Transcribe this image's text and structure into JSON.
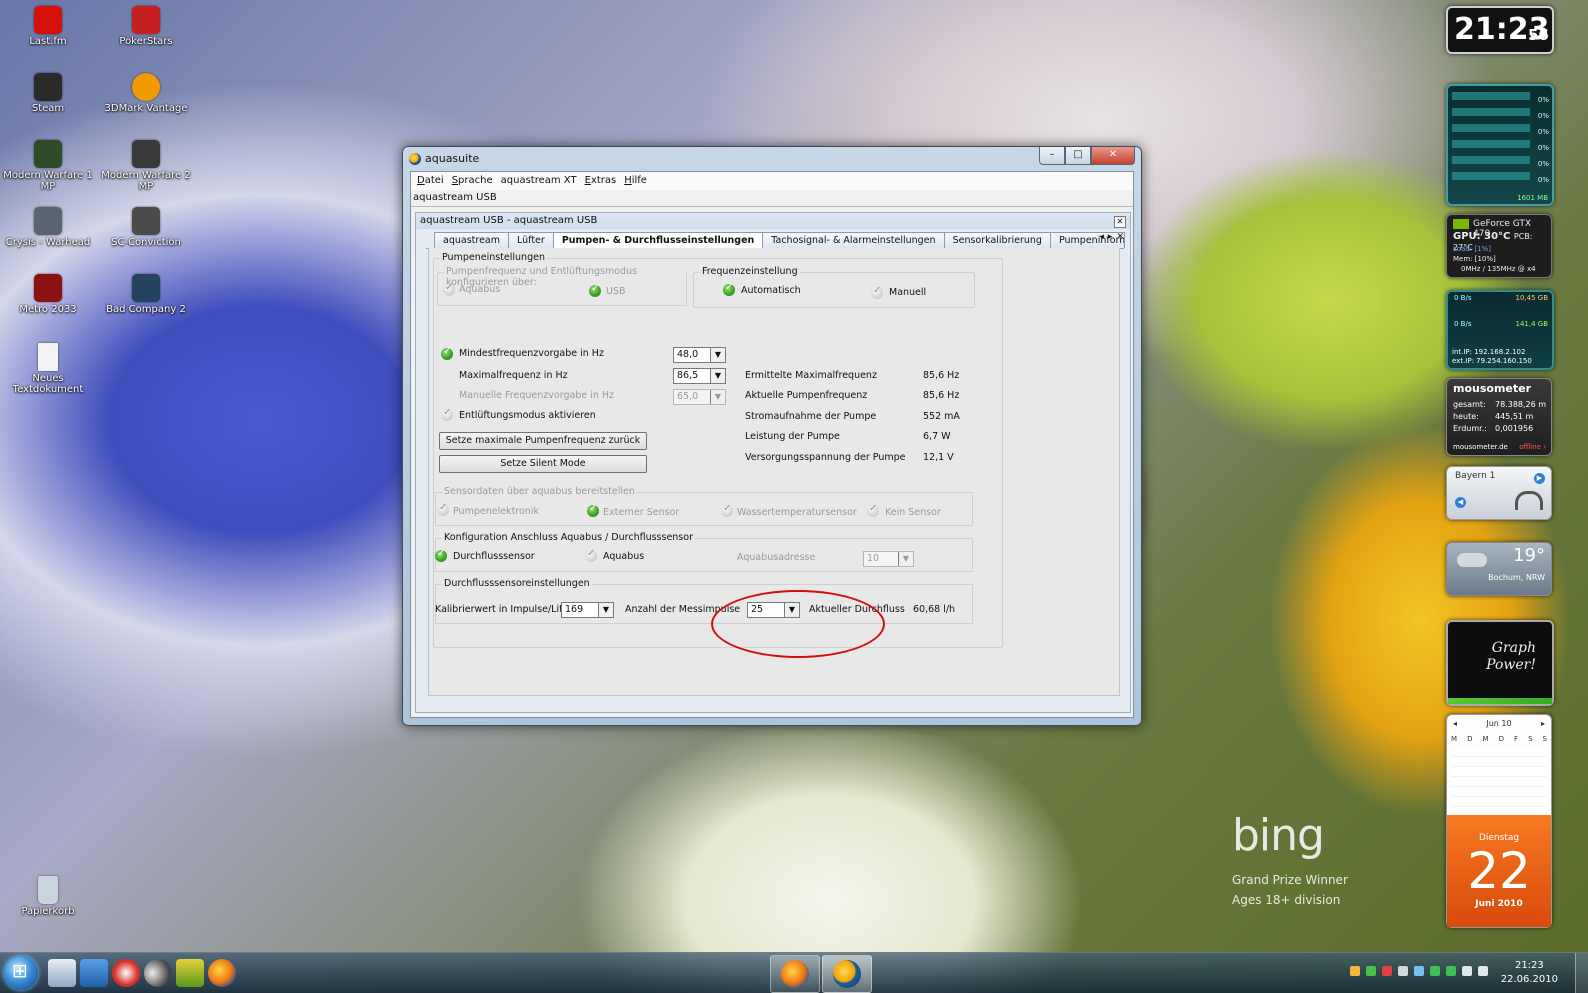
{
  "desktop": {
    "icons": [
      {
        "label": "Last.fm",
        "color": "#d51007"
      },
      {
        "label": "PokerStars",
        "color": "#c61f1f"
      },
      {
        "label": "Steam",
        "color": "#2a2a2a"
      },
      {
        "label": "3DMark Vantage",
        "color": "#f29a00"
      },
      {
        "label": "Modern Warfare 1 MP",
        "color": "#2e4b2a"
      },
      {
        "label": "Modern Warfare 2 MP",
        "color": "#3a3a3a"
      },
      {
        "label": "Crysis - Warhead",
        "color": "#5a6470"
      },
      {
        "label": "SC-Conviction",
        "color": "#4b4b4b"
      },
      {
        "label": "Metro 2033",
        "color": "#8b1010"
      },
      {
        "label": "Bad Company 2",
        "color": "#23435e"
      },
      {
        "label": "Neues Textdokument",
        "color": "#f3f3f3"
      },
      {
        "label": "Papierkorb",
        "color": "#c9d4df"
      }
    ],
    "bing": {
      "logo": "bing",
      "caption1": "Grand Prize Winner",
      "caption2": "Ages 18+ division"
    }
  },
  "gadgets": {
    "clock": {
      "time": "21:23",
      "seconds": "56"
    },
    "cpu": {
      "rows": [
        "0%",
        "0%",
        "0%",
        "0%",
        "0%",
        "0%"
      ],
      "footer": "1601 MB"
    },
    "gpu": {
      "title": "GeForce GTX 470",
      "gpu_temp": "GPU: 30°C",
      "pcb_temp": "PCB: 27°C",
      "load": "Load: [1%]",
      "mem": "Mem: [10%]",
      "clock": "0MHz / 135MHz @ x4"
    },
    "network": {
      "down": "0 B/s",
      "total_down": "10,45 GB",
      "up": "0 B/s",
      "total_up": "141,4 GB",
      "int_ip": "int.IP: 192.168.2.102",
      "ext_ip": "ext.IP: 79.254.160.150"
    },
    "mousometer": {
      "title": "mousometer",
      "gesamt_label": "gesamt:",
      "gesamt": "78.388,26 m",
      "heute_label": "heute:",
      "heute": "445,51 m",
      "erdumr_label": "Erdumr.:",
      "erdumr": "0,001956",
      "site": "mousometer.de",
      "status": "offline ›"
    },
    "radio": {
      "station": "Bayern 1"
    },
    "weather": {
      "temp": "19°",
      "location": "Bochum, NRW"
    },
    "graph": {
      "text": "Graph Power!"
    },
    "calendar": {
      "month": "Jun 10",
      "weekdays": [
        "M",
        "D",
        "M",
        "D",
        "F",
        "S",
        "S"
      ],
      "weekday_name": "Dienstag",
      "day": "22",
      "month_year": "Juni 2010"
    }
  },
  "window": {
    "title": "aquasuite",
    "menu": [
      {
        "key": "D",
        "rest": "atei"
      },
      {
        "key": "S",
        "rest": "prache"
      },
      {
        "key": "",
        "rest": "aquastream XT"
      },
      {
        "key": "E",
        "rest": "xtras"
      },
      {
        "key": "H",
        "rest": "ilfe"
      }
    ],
    "doc_strip": "aquastream USB",
    "child_title": "aquastream USB - aquastream USB",
    "tabs": [
      "aquastream",
      "Lüfter",
      "Pumpen- & Durchflusseinstellungen",
      "Tachosignal- & Alarmeinstellungen",
      "Sensorkalibrierung",
      "Pumpeninformationen & Schlüsse"
    ],
    "panel": {
      "pumpen_group": "Pumpeneinstellungen",
      "config_group": "Pumpenfrequenz und Entlüftungsmodus konfigurieren über:",
      "opt_aquabus": "Aquabus",
      "opt_usb": "USB",
      "freq_group": "Frequenzeinstellung",
      "opt_automatisch": "Automatisch",
      "opt_manuell": "Manuell",
      "min_freq_label": "Mindestfrequenzvorgabe in Hz",
      "min_freq_value": "48,0",
      "max_freq_label": "Maximalfrequenz in Hz",
      "max_freq_value": "86,5",
      "manual_freq_label": "Manuelle Frequenzvorgabe in Hz",
      "manual_freq_value": "65,0",
      "vent_label": "Entlüftungsmodus aktivieren",
      "btn_reset": "Setze maximale Pumpenfrequenz zurück",
      "btn_silent": "Setze Silent Mode",
      "info": [
        {
          "label": "Ermittelte Maximalfrequenz",
          "value": "85,6 Hz"
        },
        {
          "label": "Aktuelle Pumpenfrequenz",
          "value": "85,6 Hz"
        },
        {
          "label": "Stromaufnahme der Pumpe",
          "value": "552 mA"
        },
        {
          "label": "Leistung der Pumpe",
          "value": "6,7 W"
        },
        {
          "label": "Versorgungsspannung der Pumpe",
          "value": "12,1 V"
        }
      ],
      "sensor_group": "Sensordaten über aquabus bereitstellen",
      "sensor_opts": [
        "Pumpenelektronik",
        "Externer Sensor",
        "Wassertemperatursensor",
        "Kein Sensor"
      ],
      "anschluss_group": "Konfiguration Anschluss Aquabus / Durchflusssensor",
      "opt_durchfluss": "Durchflusssensor",
      "opt_aquabus2": "Aquabus",
      "aquabus_addr_label": "Aquabusadresse",
      "aquabus_addr_value": "10",
      "flow_group": "Durchflusssensoreinstellungen",
      "calib_label": "Kalibrierwert in Impulse/Liter",
      "calib_value": "169",
      "pulses_label": "Anzahl der Messimpulse",
      "pulses_value": "25",
      "current_flow_label": "Aktueller Durchfluss",
      "current_flow_value": "60,68 l/h"
    }
  },
  "taskbar": {
    "time": "21:23",
    "date": "22.06.2010"
  }
}
